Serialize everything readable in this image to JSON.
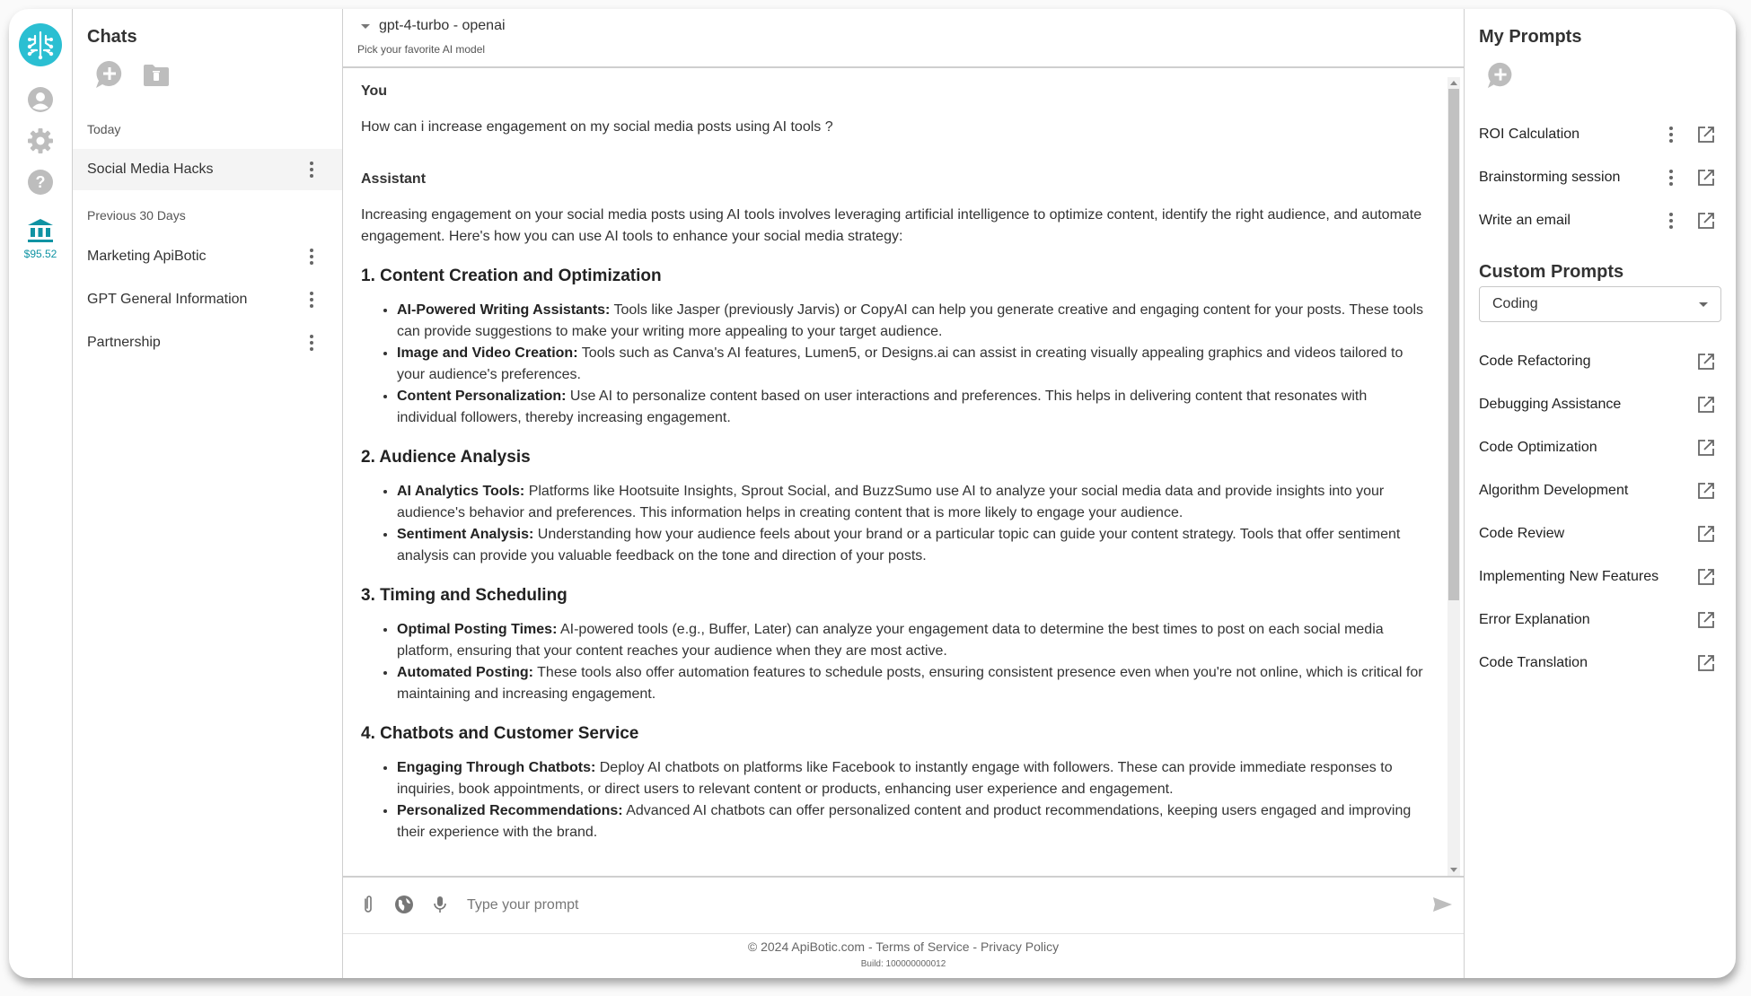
{
  "rail": {
    "logo": "apibotic-logo",
    "icons": [
      "account-icon",
      "settings-gear-icon",
      "help-icon",
      "bank-icon"
    ],
    "balance": "$95.52",
    "accent": "#2bbfd2",
    "balance_color": "#0f93a3"
  },
  "chats": {
    "title": "Chats",
    "new_chat_icon": "new-chat-icon",
    "delete_folder_icon": "folder-delete-icon",
    "sections": [
      {
        "label": "Today",
        "items": [
          {
            "label": "Social Media Hacks",
            "active": true
          }
        ]
      },
      {
        "label": "Previous 30 Days",
        "items": [
          {
            "label": "Marketing ApiBotic"
          },
          {
            "label": "GPT General Information"
          },
          {
            "label": "Partnership"
          }
        ]
      }
    ]
  },
  "main": {
    "model": "gpt-4-turbo - openai",
    "model_hint": "Pick your favorite AI model",
    "messages": {
      "user_role": "You",
      "user_text": "How can i increase engagement on my social media posts using AI tools ?",
      "assistant_role": "Assistant",
      "intro": "Increasing engagement on your social media posts using AI tools involves leveraging artificial intelligence to optimize content, identify the right audience, and automate engagement. Here's how you can use AI tools to enhance your social media strategy:",
      "sections": [
        {
          "heading": "1. Content Creation and Optimization",
          "bullets": [
            {
              "term": "AI-Powered Writing Assistants:",
              "text": " Tools like Jasper (previously Jarvis) or CopyAI can help you generate creative and engaging content for your posts. These tools can provide suggestions to make your writing more appealing to your target audience."
            },
            {
              "term": "Image and Video Creation:",
              "text": " Tools such as Canva's AI features, Lumen5, or Designs.ai can assist in creating visually appealing graphics and videos tailored to your audience's preferences."
            },
            {
              "term": "Content Personalization:",
              "text": " Use AI to personalize content based on user interactions and preferences. This helps in delivering content that resonates with individual followers, thereby increasing engagement."
            }
          ]
        },
        {
          "heading": "2. Audience Analysis",
          "bullets": [
            {
              "term": "AI Analytics Tools:",
              "text": " Platforms like Hootsuite Insights, Sprout Social, and BuzzSumo use AI to analyze your social media data and provide insights into your audience's behavior and preferences. This information helps in creating content that is more likely to engage your audience."
            },
            {
              "term": "Sentiment Analysis:",
              "text": " Understanding how your audience feels about your brand or a particular topic can guide your content strategy. Tools that offer sentiment analysis can provide you valuable feedback on the tone and direction of your posts."
            }
          ]
        },
        {
          "heading": "3. Timing and Scheduling",
          "bullets": [
            {
              "term": "Optimal Posting Times:",
              "text": " AI-powered tools (e.g., Buffer, Later) can analyze your engagement data to determine the best times to post on each social media platform, ensuring that your content reaches your audience when they are most active."
            },
            {
              "term": "Automated Posting:",
              "text": " These tools also offer automation features to schedule posts, ensuring consistent presence even when you're not online, which is critical for maintaining and increasing engagement."
            }
          ]
        },
        {
          "heading": "4. Chatbots and Customer Service",
          "bullets": [
            {
              "term": "Engaging Through Chatbots:",
              "text": " Deploy AI chatbots on platforms like Facebook to instantly engage with followers. These can provide immediate responses to inquiries, book appointments, or direct users to relevant content or products, enhancing user experience and engagement."
            },
            {
              "term": "Personalized Recommendations:",
              "text": " Advanced AI chatbots can offer personalized content and product recommendations, keeping users engaged and improving their experience with the brand."
            }
          ]
        }
      ]
    },
    "composer": {
      "placeholder": "Type your prompt",
      "icons": [
        "attach-icon",
        "web-search-globe-icon",
        "microphone-icon",
        "send-icon"
      ]
    },
    "footer": {
      "copyright": "© 2024 ApiBotic.com",
      "sep": " - ",
      "terms": "Terms of Service",
      "privacy": "Privacy Policy",
      "build": "Build: 100000000012"
    }
  },
  "right": {
    "my_prompts_title": "My Prompts",
    "my_prompts": [
      "ROI Calculation",
      "Brainstorming session",
      "Write an email"
    ],
    "custom_title": "Custom Prompts",
    "category": "Coding",
    "custom_prompts": [
      "Code Refactoring",
      "Debugging Assistance",
      "Code Optimization",
      "Algorithm Development",
      "Code Review",
      "Implementing New Features",
      "Error Explanation",
      "Code Translation"
    ]
  }
}
